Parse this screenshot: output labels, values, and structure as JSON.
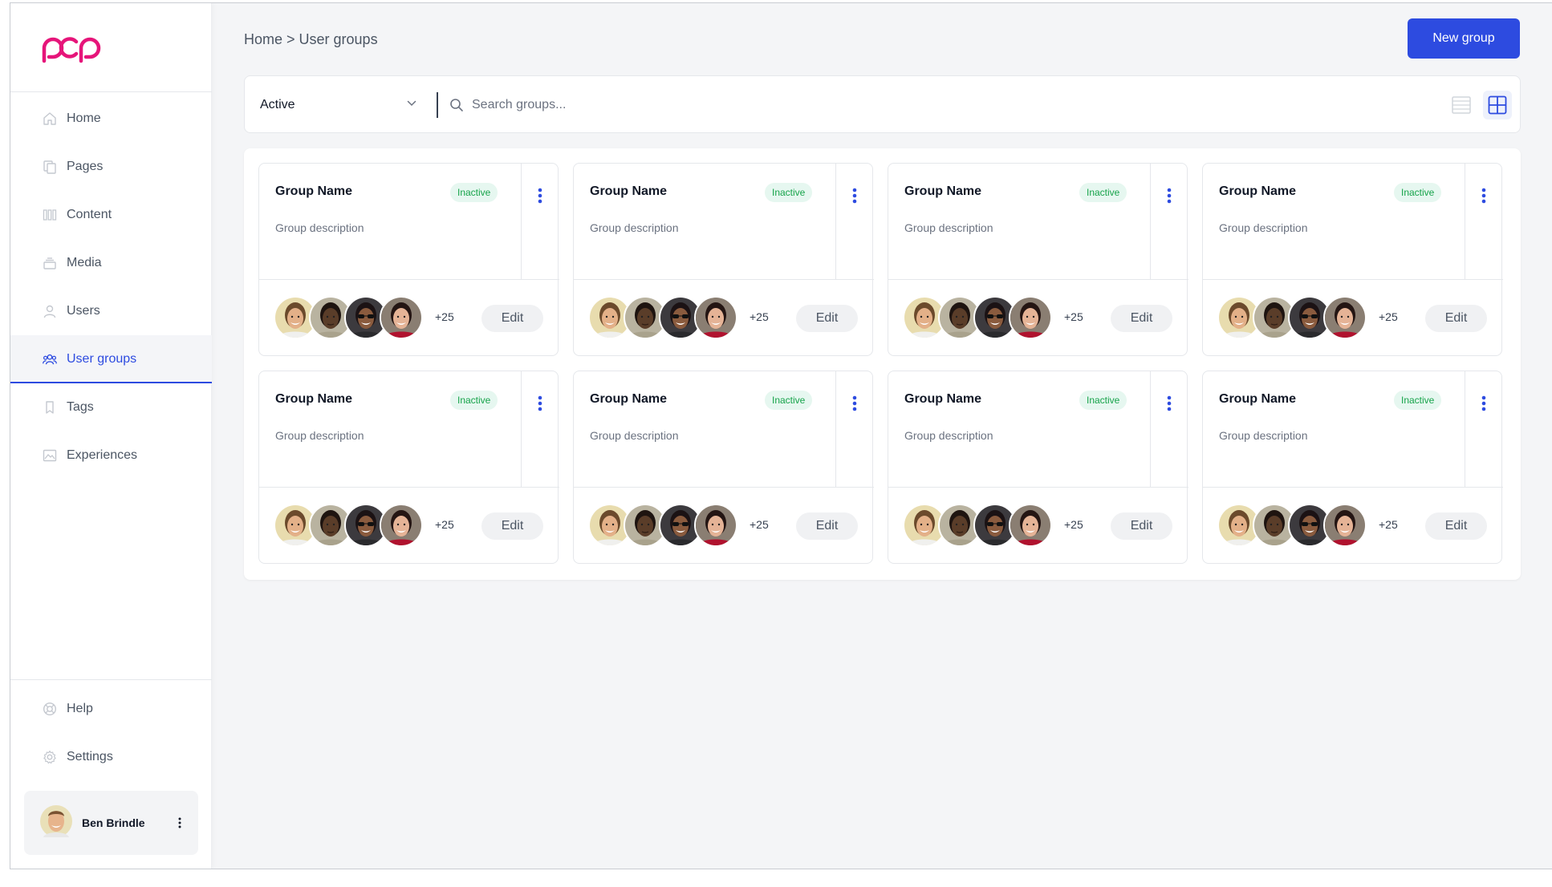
{
  "breadcrumb": "Home > User groups",
  "new_group_label": "New group",
  "sidebar": {
    "items": [
      {
        "label": "Home",
        "icon": "home-icon"
      },
      {
        "label": "Pages",
        "icon": "pages-icon"
      },
      {
        "label": "Content",
        "icon": "content-icon"
      },
      {
        "label": "Media",
        "icon": "media-icon"
      },
      {
        "label": "Users",
        "icon": "user-icon"
      },
      {
        "label": "User groups",
        "icon": "user-groups-icon",
        "active": true
      },
      {
        "label": "Tags",
        "icon": "tag-icon"
      },
      {
        "label": "Experiences",
        "icon": "experiences-icon"
      }
    ],
    "bottom_items": [
      {
        "label": "Help",
        "icon": "help-icon"
      },
      {
        "label": "Settings",
        "icon": "gear-icon"
      }
    ],
    "user_name": "Ben Brindle"
  },
  "filter": {
    "status_value": "Active",
    "search_placeholder": "Search groups..."
  },
  "groups": [
    {
      "name": "Group Name",
      "status": "Inactive",
      "description": "Group description",
      "more": "+25",
      "edit_label": "Edit"
    },
    {
      "name": "Group Name",
      "status": "Inactive",
      "description": "Group description",
      "more": "+25",
      "edit_label": "Edit"
    },
    {
      "name": "Group Name",
      "status": "Inactive",
      "description": "Group description",
      "more": "+25",
      "edit_label": "Edit"
    },
    {
      "name": "Group Name",
      "status": "Inactive",
      "description": "Group description",
      "more": "+25",
      "edit_label": "Edit"
    },
    {
      "name": "Group Name",
      "status": "Inactive",
      "description": "Group description",
      "more": "+25",
      "edit_label": "Edit"
    },
    {
      "name": "Group Name",
      "status": "Inactive",
      "description": "Group description",
      "more": "+25",
      "edit_label": "Edit"
    },
    {
      "name": "Group Name",
      "status": "Inactive",
      "description": "Group description",
      "more": "+25",
      "edit_label": "Edit"
    },
    {
      "name": "Group Name",
      "status": "Inactive",
      "description": "Group description",
      "more": "+25",
      "edit_label": "Edit"
    }
  ],
  "colors": {
    "accent": "#2d4be0",
    "brand": "#e6157a",
    "badge_text": "#16a34a",
    "badge_bg": "#e6f7f0"
  }
}
